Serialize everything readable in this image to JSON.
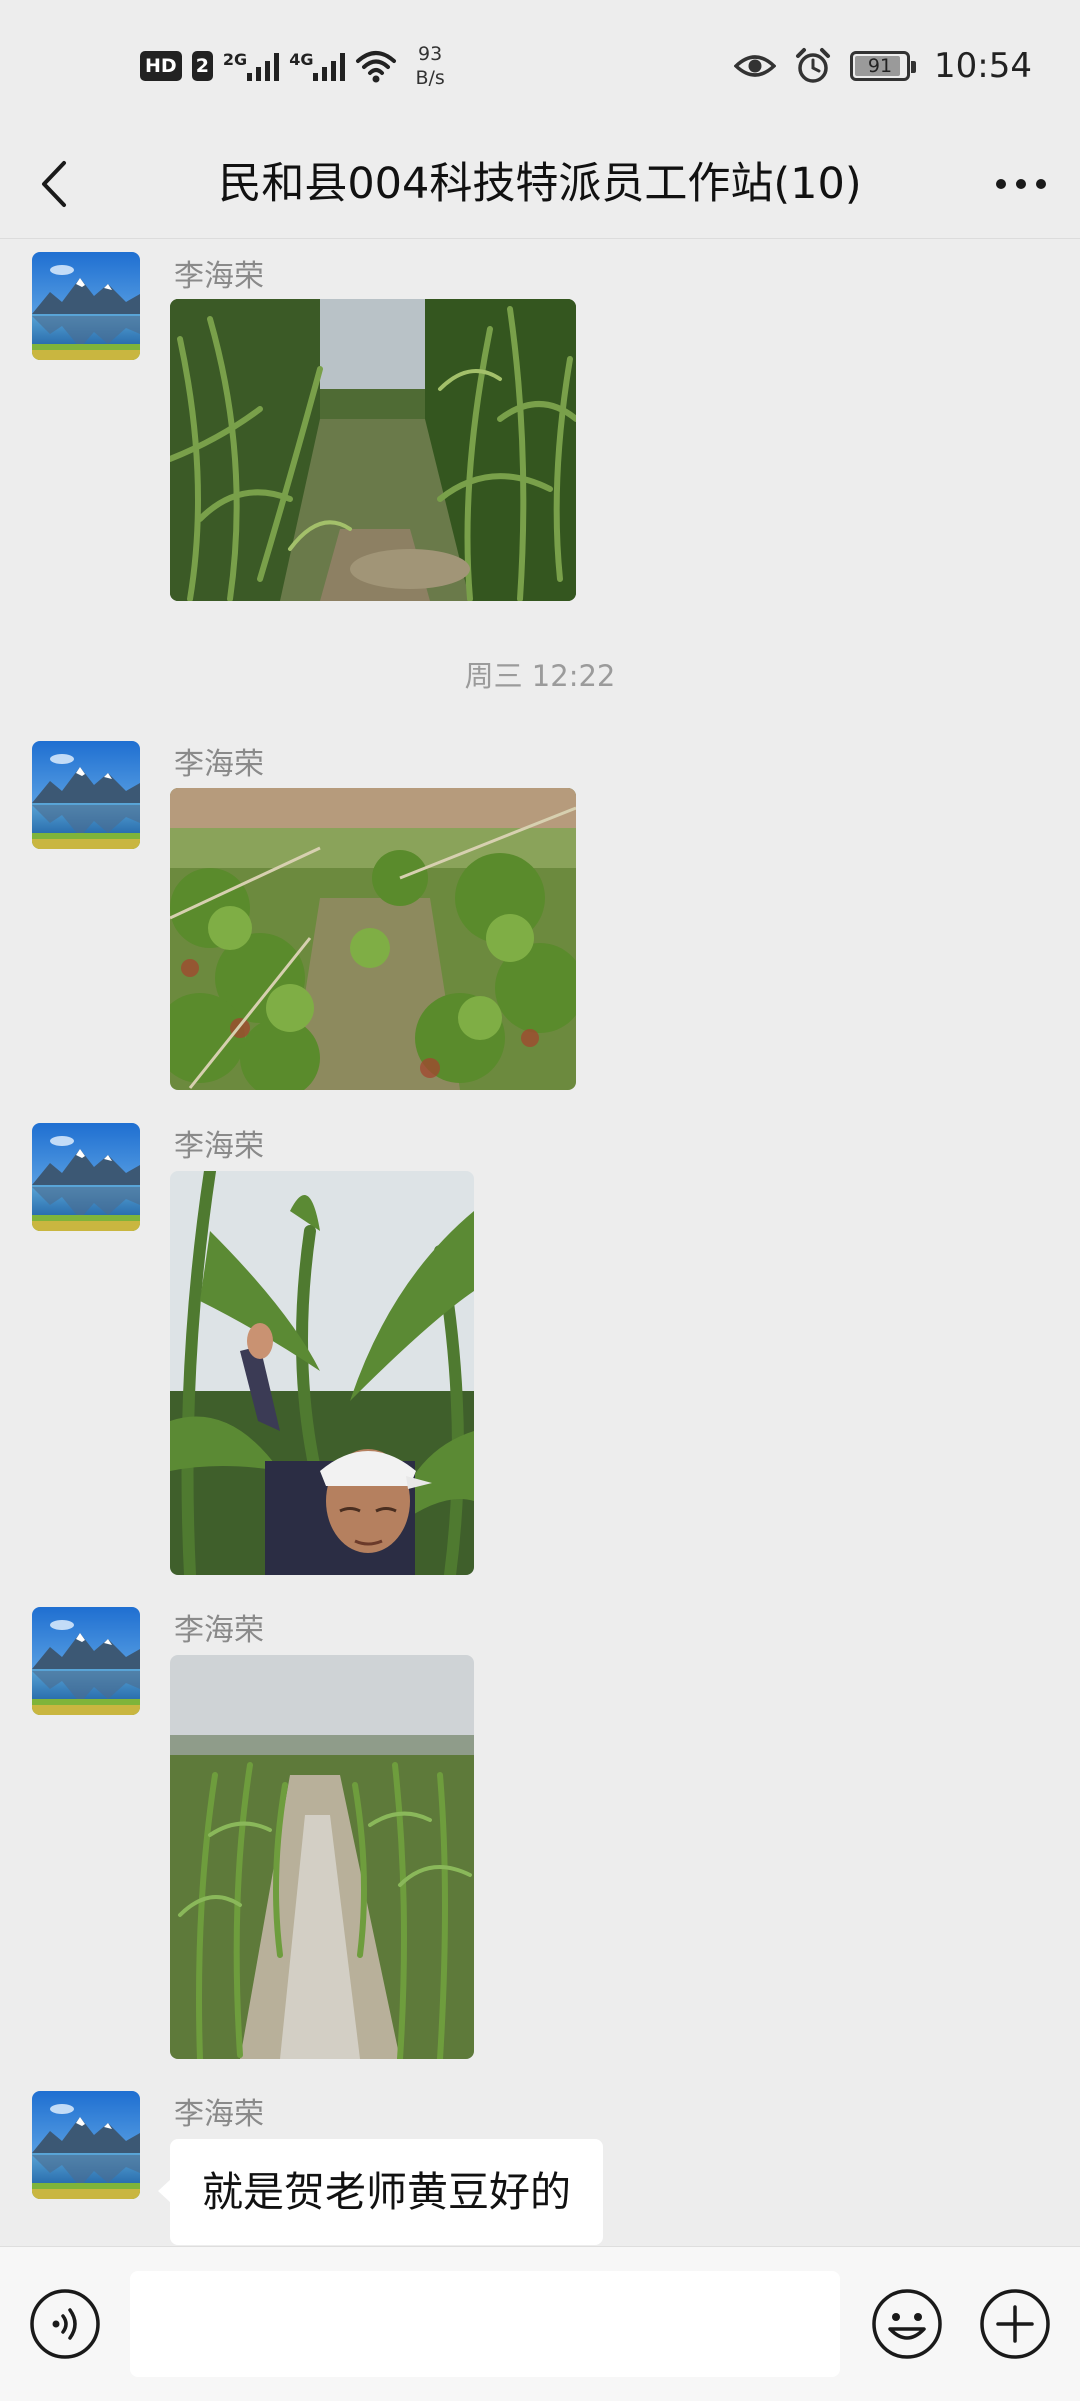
{
  "status_bar": {
    "hd_label": "HD",
    "sim_label": "2",
    "net1_label": "2G",
    "net2_label": "4G",
    "speed_value": "93",
    "speed_unit": "B/s",
    "battery_level": 91,
    "battery_text": "91",
    "time": "10:54",
    "icons": [
      "eye-icon",
      "alarm-icon",
      "battery-icon",
      "wifi-icon",
      "signal-icon"
    ]
  },
  "header": {
    "title": "民和县004科技特派员工作站(10)",
    "back_icon": "chevron-left-icon",
    "more_icon": "more-icon"
  },
  "messages": [
    {
      "sender": "李海荣",
      "type": "image",
      "description": "corn-field-row"
    },
    {
      "timestamp": "周三 12:22"
    },
    {
      "sender": "李海荣",
      "type": "image",
      "description": "bean-field"
    },
    {
      "sender": "李海荣",
      "type": "image",
      "description": "man-with-corn"
    },
    {
      "sender": "李海荣",
      "type": "image",
      "description": "corn-field-mulch"
    },
    {
      "sender": "李海荣",
      "type": "text",
      "text": "就是贺老师黄豆好的"
    }
  ],
  "input_bar": {
    "placeholder": "",
    "voice_icon": "voice-icon",
    "emoji_icon": "emoji-icon",
    "plus_icon": "plus-icon"
  },
  "colors": {
    "background": "#ededed",
    "bubble": "#ffffff",
    "sender_text": "#8a8a8a",
    "input_bar": "#f7f7f7"
  }
}
